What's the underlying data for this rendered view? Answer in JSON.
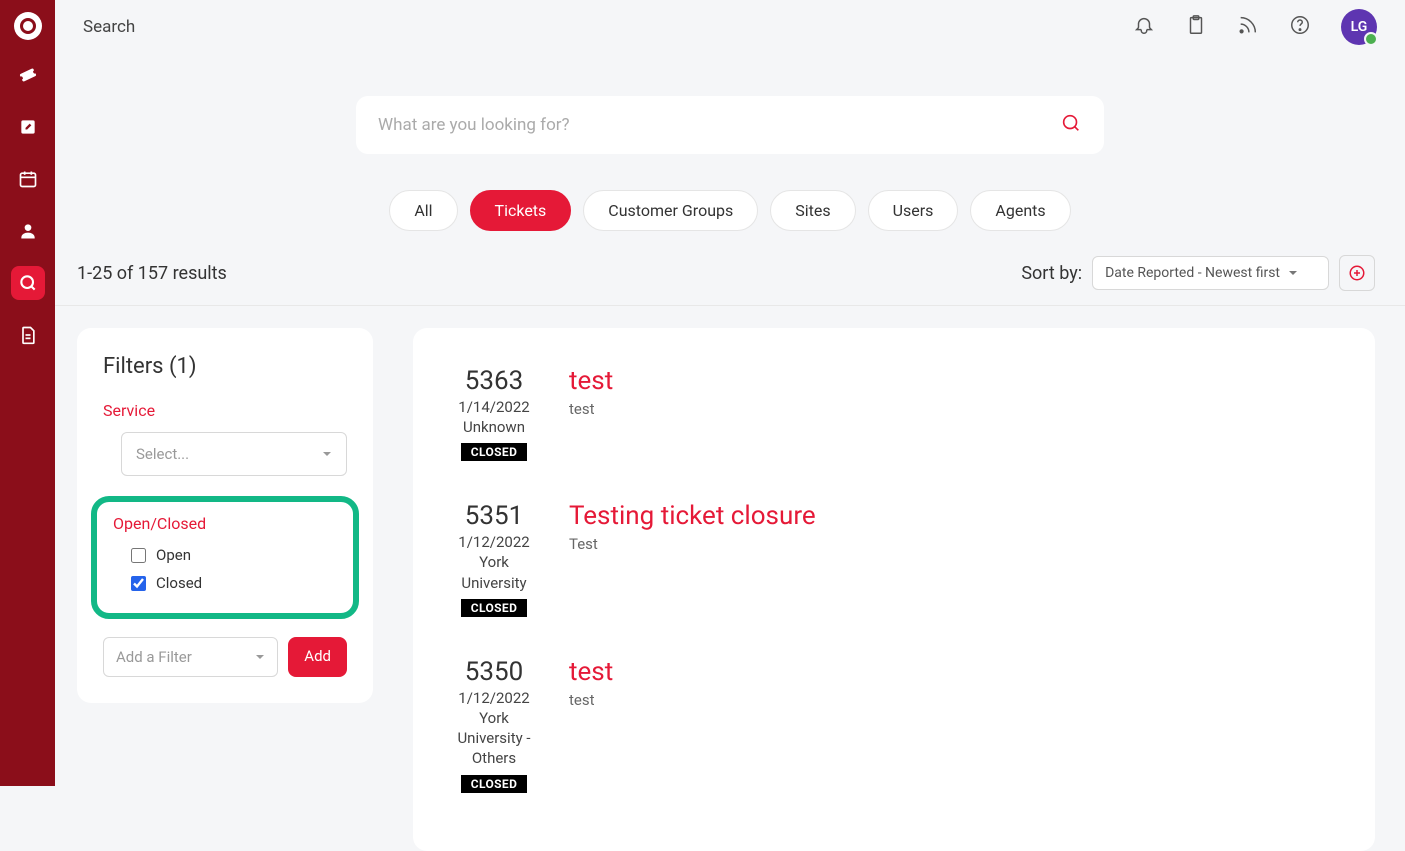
{
  "page": {
    "title": "Search"
  },
  "avatar": {
    "initials": "LG"
  },
  "search": {
    "placeholder": "What are you looking for?"
  },
  "tabs": {
    "all": "All",
    "tickets": "Tickets",
    "customer_groups": "Customer Groups",
    "sites": "Sites",
    "users": "Users",
    "agents": "Agents"
  },
  "results": {
    "count_text": "1-25 of 157 results",
    "sort_label": "Sort by:",
    "sort_value": "Date Reported - Newest first"
  },
  "filters": {
    "title": "Filters (1)",
    "service_label": "Service",
    "service_placeholder": "Select...",
    "openclosed_label": "Open/Closed",
    "open_label": "Open",
    "closed_label": "Closed",
    "add_filter_placeholder": "Add a Filter",
    "add_button": "Add"
  },
  "tickets": [
    {
      "id": "5363",
      "date": "1/14/2022",
      "org": "Unknown",
      "status": "CLOSED",
      "title": "test",
      "desc": "test"
    },
    {
      "id": "5351",
      "date": "1/12/2022",
      "org": "York University",
      "status": "CLOSED",
      "title": "Testing ticket closure",
      "desc": "Test"
    },
    {
      "id": "5350",
      "date": "1/12/2022",
      "org": "York University - Others",
      "status": "CLOSED",
      "title": "test",
      "desc": "test"
    }
  ]
}
